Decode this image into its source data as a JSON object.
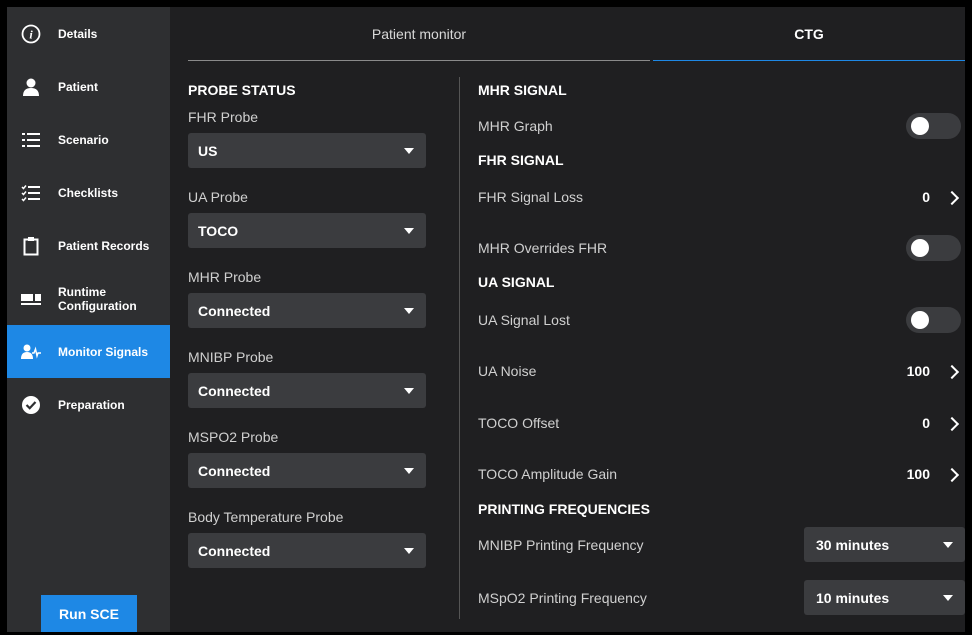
{
  "sidebar": {
    "items": [
      {
        "label": "Details",
        "icon": "info-icon"
      },
      {
        "label": "Patient",
        "icon": "person-icon"
      },
      {
        "label": "Scenario",
        "icon": "list-icon"
      },
      {
        "label": "Checklists",
        "icon": "checklist-icon"
      },
      {
        "label": "Patient Records",
        "icon": "clipboard-icon"
      },
      {
        "label": "Runtime Configuration",
        "label_line1": "Runtime",
        "label_line2": "Configuration",
        "icon": "config-icon"
      },
      {
        "label": "Monitor Signals",
        "icon": "monitor-signals-icon",
        "active": true
      },
      {
        "label": "Preparation",
        "icon": "check-circle-icon"
      }
    ],
    "run_button": "Run SCE"
  },
  "tabs": {
    "patient_monitor": "Patient monitor",
    "ctg": "CTG",
    "active": "CTG"
  },
  "probe_status": {
    "title": "PROBE STATUS",
    "probes": [
      {
        "label": "FHR Probe",
        "value": "US"
      },
      {
        "label": "UA Probe",
        "value": "TOCO"
      },
      {
        "label": "MHR Probe",
        "value": "Connected"
      },
      {
        "label": "MNIBP Probe",
        "value": "Connected"
      },
      {
        "label": "MSPO2 Probe",
        "value": "Connected"
      },
      {
        "label": "Body Temperature Probe",
        "value": "Connected"
      }
    ]
  },
  "mhr_signal": {
    "title": "MHR SIGNAL",
    "mhr_graph": {
      "label": "MHR Graph",
      "on": false
    }
  },
  "fhr_signal": {
    "title": "FHR SIGNAL",
    "fhr_signal_loss": {
      "label": "FHR Signal Loss",
      "value": "0"
    },
    "mhr_overrides_fhr": {
      "label": "MHR Overrides FHR",
      "on": false
    }
  },
  "ua_signal": {
    "title": "UA SIGNAL",
    "ua_signal_lost": {
      "label": "UA Signal Lost",
      "on": false
    },
    "ua_noise": {
      "label": "UA Noise",
      "value": "100"
    },
    "toco_offset": {
      "label": "TOCO Offset",
      "value": "0"
    },
    "toco_amplitude_gain": {
      "label": "TOCO Amplitude Gain",
      "value": "100"
    }
  },
  "printing": {
    "title": "PRINTING FREQUENCIES",
    "mnibp": {
      "label": "MNIBP Printing Frequency",
      "value": "30 minutes"
    },
    "mspo2": {
      "label": "MSpO2 Printing Frequency",
      "value": "10 minutes"
    }
  },
  "colors": {
    "accent": "#1e88e5",
    "sidebar_bg": "#2e2f31",
    "main_bg": "#1f1f21",
    "control_bg": "#3b3c3f"
  }
}
